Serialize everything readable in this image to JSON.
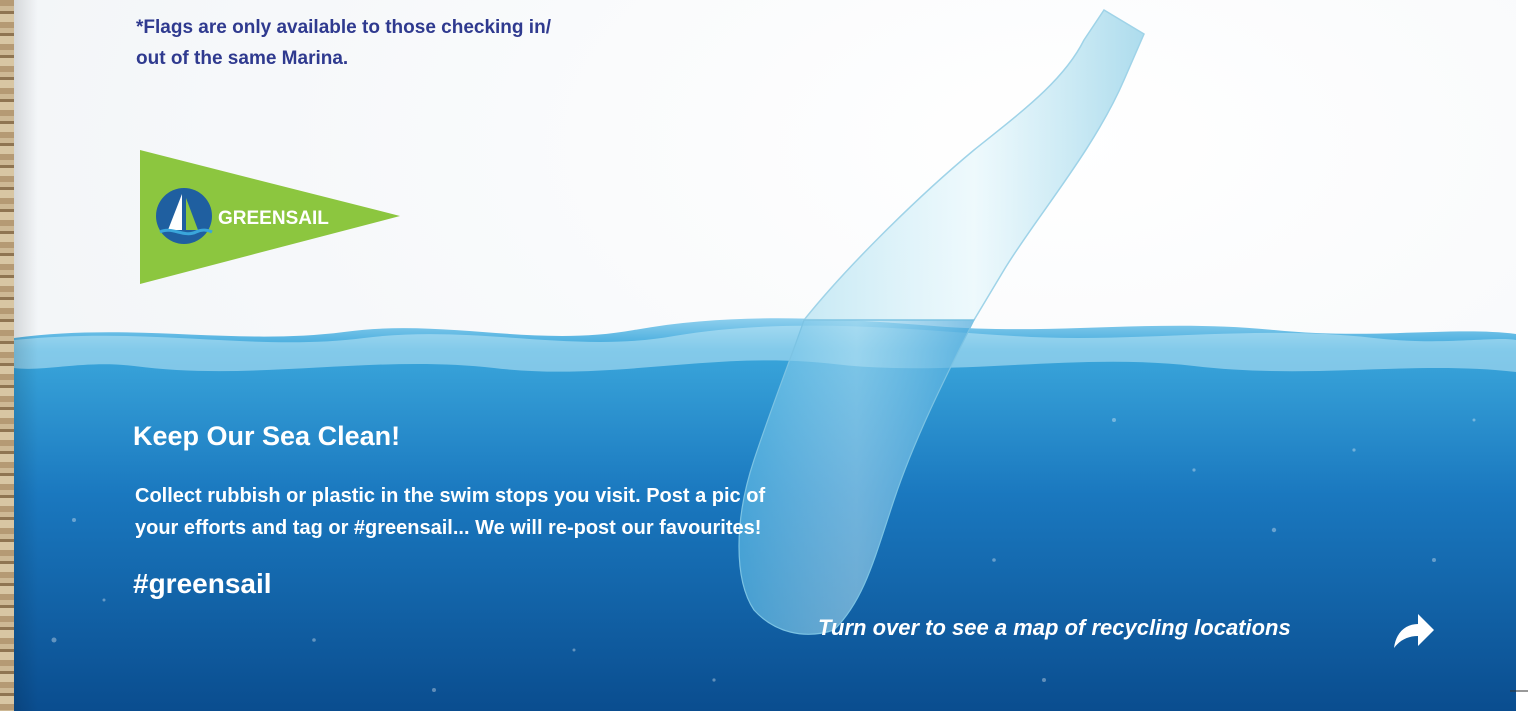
{
  "flag_note": {
    "line1": "*Flags are only available to those checking in/",
    "line2": "out of the same Marina."
  },
  "logo": {
    "text": "GREENSAIL",
    "pennant_color": "#8cc63f",
    "circle_color": "#1f5fa0"
  },
  "campaign": {
    "title": "Keep Our Sea Clean!",
    "body_line1": "Collect rubbish or plastic in the swim stops you visit. Post a pic of",
    "body_line2": "your efforts and tag or #greensail... We will re-post our favourites!",
    "hashtag": "#greensail"
  },
  "footer": {
    "turn_over": "Turn over to see a map of recycling locations",
    "arrow_icon": "curved-forward-arrow-icon"
  },
  "colors": {
    "text_navy": "#2f3a8f",
    "sea_light": "#3aa6db",
    "sea_dark": "#0a4d8f",
    "text_white": "#ffffff"
  }
}
